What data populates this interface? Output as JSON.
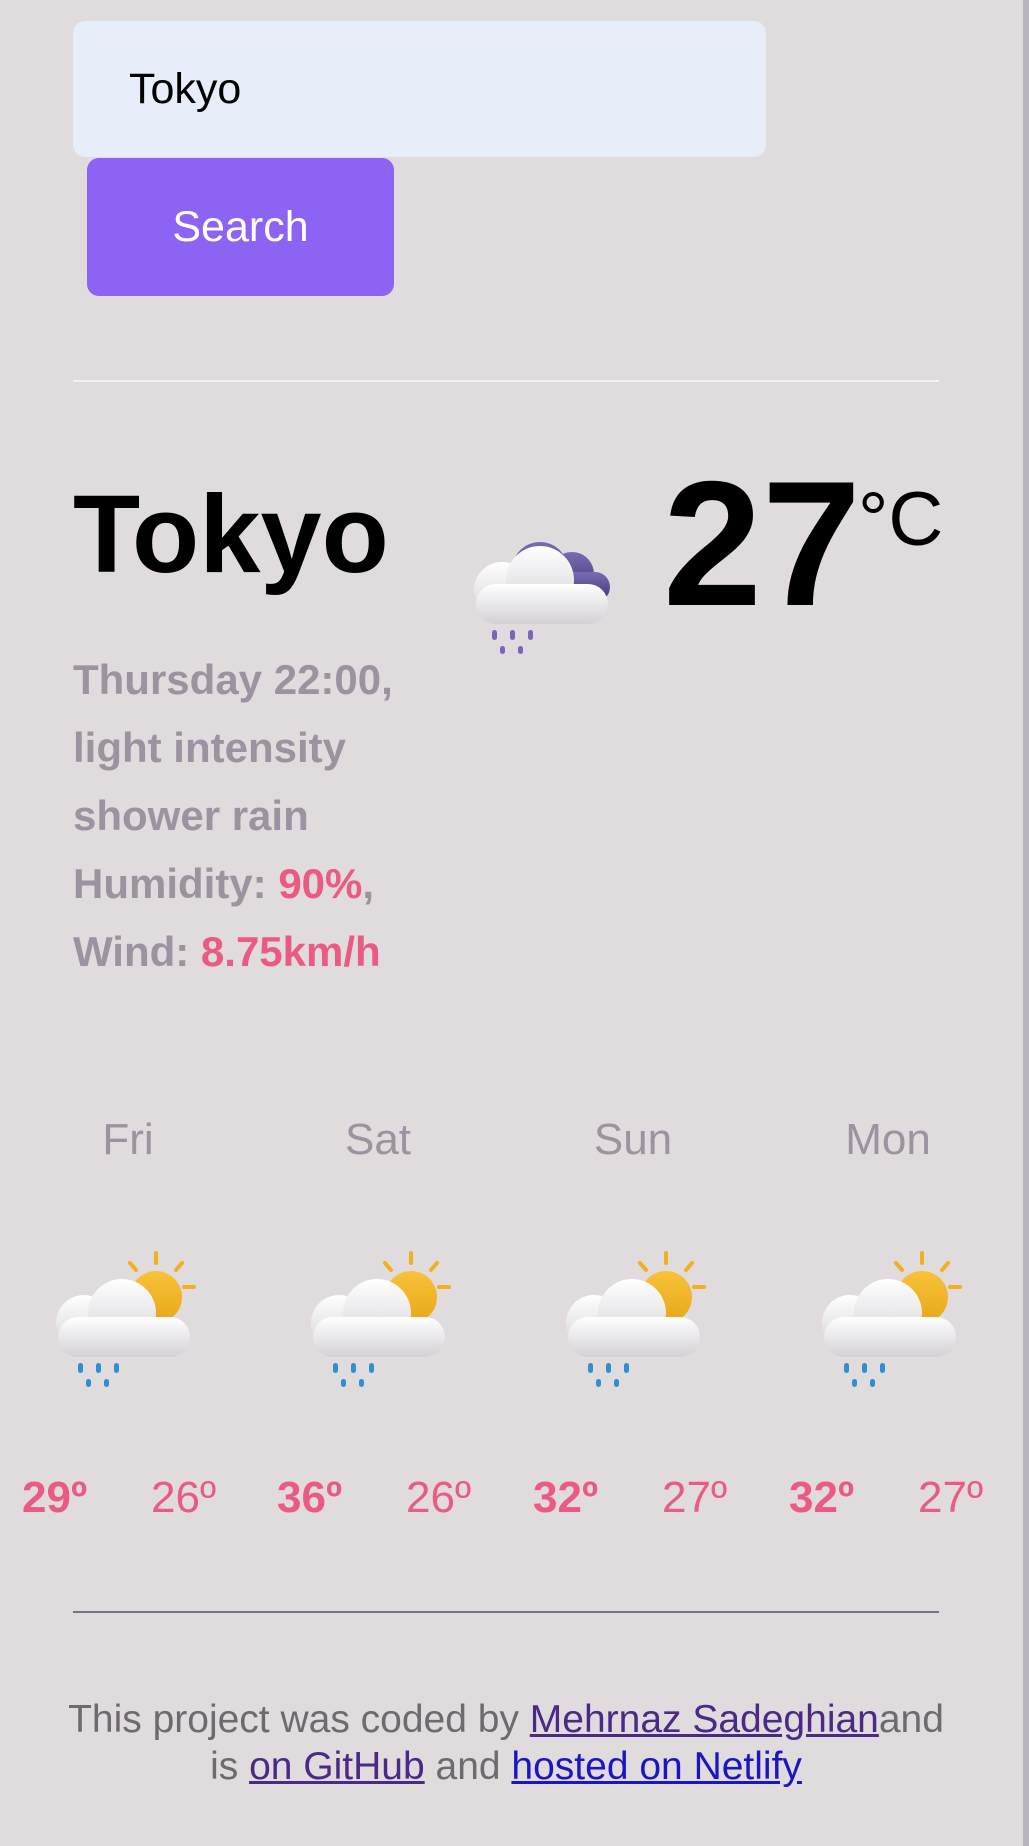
{
  "search": {
    "input_value": "Tokyo",
    "button_label": "Search"
  },
  "current": {
    "city": "Tokyo",
    "datetime": "Thursday 22:00,",
    "description": "light intensity shower rain",
    "humidity_label": "Humidity: ",
    "humidity_value": "90%",
    "wind_label": "Wind: ",
    "wind_value": "8.75km/h",
    "temperature": "27",
    "unit": "°C",
    "icon": "night-cloud-rain-icon"
  },
  "forecast": [
    {
      "day": "Fri",
      "max": "29º",
      "min": "26º",
      "icon": "sun-cloud-rain-icon"
    },
    {
      "day": "Sat",
      "max": "36º",
      "min": "26º",
      "icon": "sun-cloud-rain-icon"
    },
    {
      "day": "Sun",
      "max": "32º",
      "min": "27º",
      "icon": "sun-cloud-rain-icon"
    },
    {
      "day": "Mon",
      "max": "32º",
      "min": "27º",
      "icon": "sun-cloud-rain-icon"
    }
  ],
  "footer": {
    "text1": "This project was coded by ",
    "author_link": "Mehrnaz Sadeghian",
    "text2": "and is ",
    "github_link": "on GitHub",
    "text3": " and ",
    "netlify_link": "hosted on Netlify"
  },
  "colors": {
    "background": "#e0dbdc",
    "accent_button": "#8c63f2",
    "highlight": "#ea5a82",
    "muted_text": "#9b94a0",
    "input_bg": "#e8edfa"
  }
}
